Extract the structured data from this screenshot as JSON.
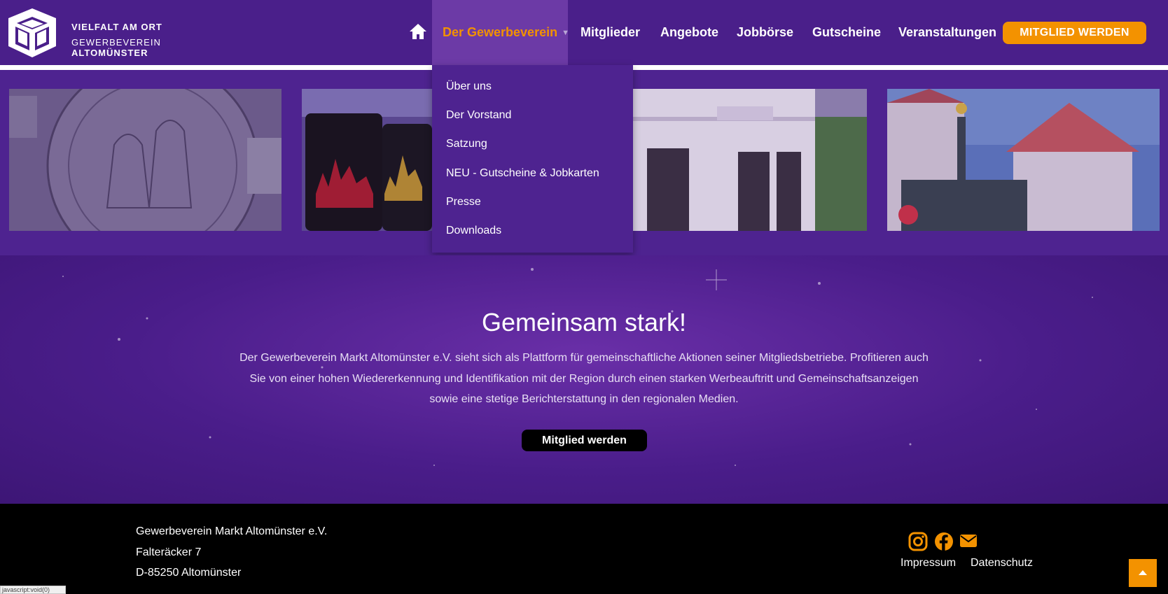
{
  "brand": {
    "line1": "VIELFALT AM ORT",
    "line2": "GEWERBEVEREIN",
    "line3": "ALTOMÜNSTER"
  },
  "nav": {
    "active": "Der Gewerbeverein",
    "items": [
      "Mitglieder",
      "Angebote",
      "Jobbörse",
      "Gutscheine",
      "Veranstaltungen"
    ],
    "cta": "MITGLIED WERDEN"
  },
  "dropdown": {
    "items": [
      "Über uns",
      "Der Vorstand",
      "Satzung",
      "NEU - Gutscheine & Jobkarten",
      "Presse",
      "Downloads"
    ]
  },
  "hero": {
    "title": "Gemeinsam stark!",
    "text": "Der Gewerbeverein Markt Altomünster e.V. sieht sich als Plattform für gemeinschaftliche Aktionen seiner Mitgliedsbetriebe. Profitieren auch Sie von einer hohen Wiedererkennung und Identifikation mit der Region durch einen starken Werbeauftritt und Gemeinschaftsanzeigen sowie eine stetige Berichterstattung in den regionalen Medien.",
    "button": "Mitglied werden"
  },
  "footer": {
    "address": [
      "Gewerbeverein Markt Altomünster e.V.",
      "Falteräcker 7",
      "D-85250 Altomünster"
    ],
    "links": [
      "Impressum",
      "Datenschutz"
    ]
  },
  "statusbar": "javascript:void(0)",
  "colors": {
    "purple": "#4a1f8a",
    "accent": "#f39200",
    "footer": "#000000"
  }
}
